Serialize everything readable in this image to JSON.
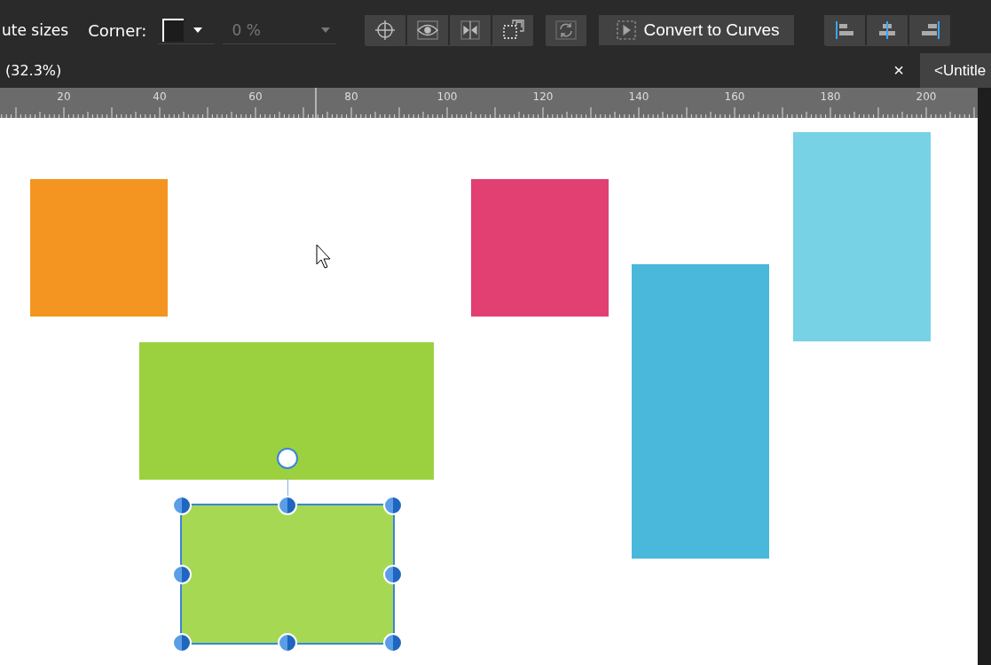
{
  "toolbar": {
    "size_label": "ute sizes",
    "corner_label": "Corner:",
    "corner_value": {
      "placeholder": "0 %",
      "disabled": true
    },
    "convert_button": "Convert to Curves"
  },
  "document_bar": {
    "zoom": "(32.3%)",
    "close": "×",
    "tab": "<Untitle"
  },
  "ruler": {
    "labels": [
      "20",
      "40",
      "60",
      "80",
      "100",
      "120",
      "140",
      "160",
      "180",
      "200"
    ]
  },
  "shapes": [
    {
      "kind": "rect",
      "color": "#f39520",
      "selected": false
    },
    {
      "kind": "rect",
      "color": "#e23f72",
      "selected": false
    },
    {
      "kind": "rect",
      "color": "#77d2e6",
      "selected": false
    },
    {
      "kind": "rect",
      "color": "#4ab8db",
      "selected": false
    },
    {
      "kind": "rect",
      "color": "#9bd13e",
      "selected": false
    },
    {
      "kind": "rect",
      "color": "#a6d854",
      "selected": true
    }
  ]
}
